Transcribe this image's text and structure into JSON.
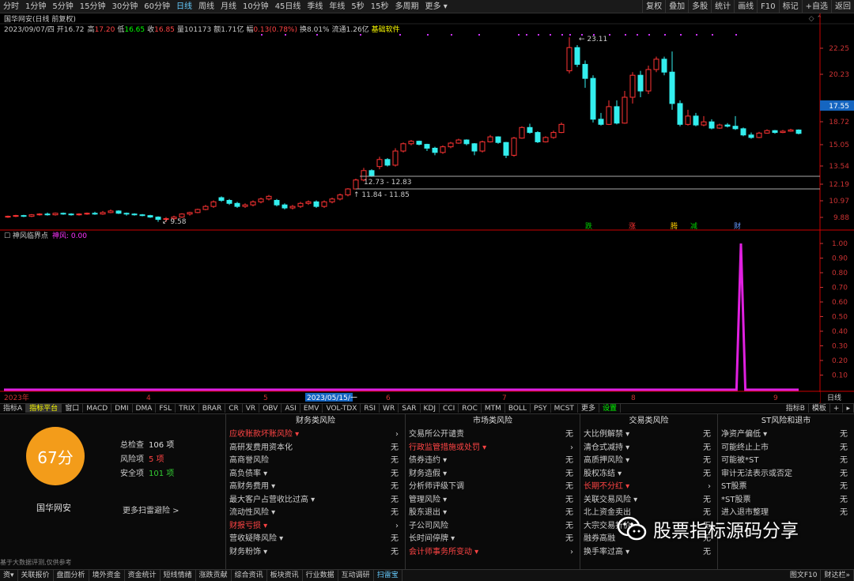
{
  "topbar": {
    "periods": [
      "分时",
      "1分钟",
      "5分钟",
      "15分钟",
      "30分钟",
      "60分钟",
      "日线",
      "周线",
      "月线",
      "10分钟",
      "45日线",
      "季线",
      "年线",
      "5秒",
      "15秒",
      "多周期",
      "更多 ▾"
    ],
    "active": "日线",
    "right": [
      "复权",
      "叠加",
      "多股",
      "统计",
      "画线",
      "F10",
      "标记",
      "+自选",
      "返回"
    ]
  },
  "header": {
    "title": "国华网安(日线 前复权)",
    "date_line": "2023/09/07/四 开16.72",
    "stats": [
      {
        "k": "高",
        "v": "17.20",
        "c": "#f44"
      },
      {
        "k": "低",
        "v": "16.65",
        "c": "#0f0"
      },
      {
        "k": "收",
        "v": "16.85",
        "c": "#f44"
      },
      {
        "k": "量",
        "v": "101173",
        "c": "#ccc"
      },
      {
        "k": "额",
        "v": "1.71亿",
        "c": "#ccc"
      },
      {
        "k": "幅",
        "v": "0.13(0.78%)",
        "c": "#f44"
      },
      {
        "k": "换",
        "v": "8.01%",
        "c": "#ccc"
      },
      {
        "k": "流通",
        "v": "1.26亿",
        "c": "#ccc"
      },
      {
        "k": "",
        "v": "基础软件",
        "c": "#ff0"
      }
    ]
  },
  "indicator": {
    "name": "神风临界点",
    "series": "神风: 0.00"
  },
  "price_axis": [
    "22.25",
    "20.23",
    "18.72",
    "17.55",
    "15.05",
    "13.54",
    "12.19",
    "10.97",
    "9.88"
  ],
  "current_price": "17.55",
  "ind_axis": [
    "1.00",
    "0.90",
    "0.80",
    "0.70",
    "0.60",
    "0.50",
    "0.40",
    "0.30",
    "0.20",
    "0.10"
  ],
  "date_axis": {
    "labels": [
      "2023年",
      "4",
      "5",
      "2023/05/15/一",
      "6",
      "7",
      "8",
      "9"
    ],
    "right": "日线"
  },
  "annotations": {
    "high": "23.11",
    "low": "9.58",
    "band1": "12.73 - 12.83",
    "band2": "11.84 - 11.85"
  },
  "markers": [
    "跌",
    "涨",
    "腾",
    "减",
    "财"
  ],
  "chart_data": {
    "type": "line",
    "ylim": [
      0,
      1
    ],
    "values": [
      0,
      0,
      0,
      0,
      0,
      0,
      0,
      0,
      0,
      0,
      0,
      0,
      0,
      0,
      0,
      0,
      0,
      0,
      0,
      0,
      0,
      0,
      0,
      0,
      0,
      0,
      0,
      0,
      0,
      0,
      0,
      0,
      0,
      0,
      0,
      0,
      0,
      0,
      0,
      0,
      0,
      0,
      0,
      0,
      0,
      0,
      0,
      0,
      0,
      0,
      0,
      0,
      0,
      0,
      0,
      0,
      0,
      0,
      0,
      0,
      0,
      0,
      0,
      0,
      0,
      0,
      0,
      0,
      0,
      0,
      0,
      0,
      0,
      0,
      0,
      0,
      0,
      0,
      0,
      0,
      0,
      0,
      0,
      0,
      0,
      0,
      0,
      0,
      0,
      0,
      0,
      0,
      0,
      0,
      0,
      0,
      0,
      0,
      0,
      0,
      0,
      0,
      0,
      0,
      0,
      0,
      0,
      0,
      0,
      0,
      0,
      0,
      0,
      0,
      0,
      0,
      0,
      0,
      0,
      0,
      0,
      0,
      0,
      0,
      0,
      0,
      0,
      0,
      0,
      0,
      0,
      0,
      0,
      0,
      0,
      0,
      0,
      0,
      0,
      0,
      0,
      0,
      0,
      0,
      0,
      0,
      0,
      0,
      0,
      0,
      0,
      0,
      0,
      0,
      0,
      0,
      0,
      0,
      0,
      0,
      0,
      0,
      0,
      0,
      0,
      0,
      1,
      0,
      0,
      0,
      0,
      0,
      0,
      0,
      0,
      0,
      0,
      0,
      0,
      0
    ]
  },
  "indicator_tabs": {
    "items": [
      "指标A",
      "指标平台",
      "窗口",
      "MACD",
      "DMI",
      "DMA",
      "FSL",
      "TRIX",
      "BRAR",
      "CR",
      "VR",
      "OBV",
      "ASI",
      "EMV",
      "VOL-TDX",
      "RSI",
      "WR",
      "SAR",
      "KDJ",
      "CCI",
      "ROC",
      "MTM",
      "BOLL",
      "PSY",
      "MCST",
      "更多",
      "设置"
    ],
    "active": "指标平台",
    "right": [
      "指标B",
      "模板",
      "+",
      "▸"
    ]
  },
  "score": {
    "value": "67分",
    "name": "国华网安",
    "total_label": "总检查",
    "total": "106 项",
    "risk_label": "风险项",
    "risk": "5 项",
    "safe_label": "安全项",
    "safe": "101 项",
    "more": "更多扫雷避险 >",
    "note": "基于大数据评测,仅供参考"
  },
  "columns": [
    {
      "title": "财务类风险",
      "rows": [
        {
          "n": "应收账款坏账风险 ▾",
          "v": "›",
          "r": true
        },
        {
          "n": "高研发费用资本化",
          "v": "无"
        },
        {
          "n": "高商誉风险",
          "v": "无"
        },
        {
          "n": "高负债率 ▾",
          "v": "无"
        },
        {
          "n": "高财务费用 ▾",
          "v": "无"
        },
        {
          "n": "最大客户占营收比过高 ▾",
          "v": "无"
        },
        {
          "n": "流动性风险 ▾",
          "v": "无"
        },
        {
          "n": "财报亏损 ▾",
          "v": "›",
          "r": true
        },
        {
          "n": "营收疑降风险 ▾",
          "v": "无"
        },
        {
          "n": "财务粉饰 ▾",
          "v": "无"
        }
      ]
    },
    {
      "title": "市场类风险",
      "rows": [
        {
          "n": "交易所公开谴责",
          "v": "无"
        },
        {
          "n": "行政监管措施或处罚 ▾",
          "v": "›",
          "r": true
        },
        {
          "n": "债券违约 ▾",
          "v": "无"
        },
        {
          "n": "财务造假 ▾",
          "v": "无"
        },
        {
          "n": "分析师评级下调",
          "v": "无"
        },
        {
          "n": "管理风险 ▾",
          "v": "无"
        },
        {
          "n": "股东退出 ▾",
          "v": "无"
        },
        {
          "n": "子公司风险",
          "v": "无"
        },
        {
          "n": "长时间停牌 ▾",
          "v": "无"
        },
        {
          "n": "会计师事务所变动 ▾",
          "v": "›",
          "r": true
        }
      ]
    },
    {
      "title": "交易类风险",
      "rows": [
        {
          "n": "大比例解禁 ▾",
          "v": "无"
        },
        {
          "n": "清仓式减持 ▾",
          "v": "无"
        },
        {
          "n": "高质押风险 ▾",
          "v": "无"
        },
        {
          "n": "股权冻结 ▾",
          "v": "无"
        },
        {
          "n": "长期不分红 ▾",
          "v": "›",
          "r": true
        },
        {
          "n": "关联交易风险 ▾",
          "v": "无"
        },
        {
          "n": "北上资金卖出",
          "v": "无"
        },
        {
          "n": "大宗交易折价",
          "v": "无"
        },
        {
          "n": "融券高融",
          "v": "无"
        },
        {
          "n": "换手率过高 ▾",
          "v": "无"
        }
      ]
    },
    {
      "title": "ST风险和退市",
      "rows": [
        {
          "n": "净资产偏低 ▾",
          "v": "无"
        },
        {
          "n": "可能终止上市",
          "v": "无"
        },
        {
          "n": "可能被*ST",
          "v": "无"
        },
        {
          "n": "审计无法表示或否定",
          "v": "无"
        },
        {
          "n": "ST股票",
          "v": "无"
        },
        {
          "n": "*ST股票",
          "v": "无"
        },
        {
          "n": "进入退市整理",
          "v": "无"
        }
      ]
    }
  ],
  "watermark": "股票指标源码分享",
  "bottombar": {
    "items": [
      "资▾",
      "关联报价",
      "盘面分析",
      "境外资金",
      "资金统计",
      "短线情绪",
      "涨跌贡献",
      "综合资讯",
      "板块资讯",
      "行业数据",
      "互动调研",
      "扫雷宝"
    ],
    "active": "扫雷宝",
    "right": [
      "图文F10",
      "财达栏»"
    ]
  }
}
